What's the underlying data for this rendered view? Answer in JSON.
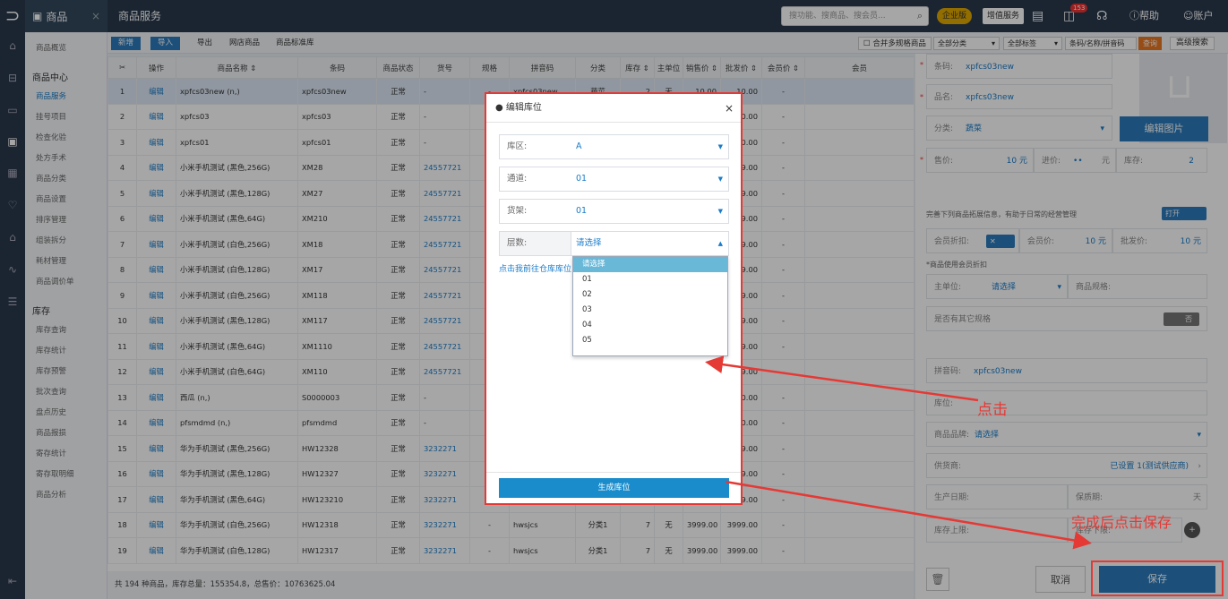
{
  "topbar": {
    "module_name": "商品",
    "close_glyph": "×",
    "page_title": "商品服务",
    "search_placeholder": "搜功能、搜商品、搜会员...",
    "search_icon": "search-icon",
    "enterprise_badge": "企业版",
    "value_service": "增值服务",
    "notify_count": "153",
    "help": "帮助",
    "account": "账户"
  },
  "rail": {
    "icons": [
      "home-icon",
      "store-icon",
      "card-icon",
      "goods-icon",
      "report-icon",
      "member-icon",
      "shop-icon",
      "chart-icon",
      "settings-icon"
    ]
  },
  "sidebar": {
    "overview": "商品概览",
    "center_heading": "商品中心",
    "center_items": [
      "商品服务",
      "挂号项目",
      "检查化验",
      "处方手术",
      "商品分类",
      "商品设置",
      "排序管理",
      "组装拆分",
      "耗材管理",
      "商品调价单"
    ],
    "stock_heading": "库存",
    "stock_items": [
      "库存查询",
      "库存统计",
      "库存预警",
      "批次查询",
      "盘点历史",
      "商品报损",
      "寄存统计",
      "寄存取明细",
      "商品分析"
    ]
  },
  "toolbar": {
    "new": "新增",
    "import": "导入",
    "export": "导出",
    "store_goods": "网店商品",
    "std_lib": "商品标准库",
    "merge": "合并多规格商品",
    "filter_category": "全部分类",
    "filter_tag": "全部标签",
    "filter_search": "条码/名称/拼音码",
    "query": "查询",
    "advanced": "高级搜索"
  },
  "table": {
    "headers": [
      "",
      "操作",
      "商品名称 ⇕",
      "条码",
      "商品状态",
      "货号",
      "规格",
      "拼音码",
      "分类",
      "库存 ⇕",
      "主单位",
      "销售价 ⇕",
      "批发价 ⇕",
      "会员价 ⇕",
      "会员"
    ],
    "rows": [
      [
        "1",
        "编辑",
        "xpfcs03new (n,)",
        "xpfcs03new",
        "正常",
        "-",
        "-",
        "xpfcs03new",
        "蔬菜",
        "2",
        "无",
        "10.00",
        "10.00",
        "-"
      ],
      [
        "2",
        "编辑",
        "xpfcs03",
        "xpfcs03",
        "正常",
        "-",
        "",
        "",
        "",
        "",
        "",
        "10.00",
        "10.00",
        "-"
      ],
      [
        "3",
        "编辑",
        "xpfcs01",
        "xpfcs01",
        "正常",
        "-",
        "",
        "",
        "",
        "",
        "",
        "10.00",
        "10.00",
        "-"
      ],
      [
        "4",
        "编辑",
        "小米手机测试 (黑色,256G)",
        "XM28",
        "正常",
        "24557721",
        "",
        "",
        "",
        "",
        "",
        "3999.00",
        "3999.00",
        "-"
      ],
      [
        "5",
        "编辑",
        "小米手机测试 (黑色,128G)",
        "XM27",
        "正常",
        "24557721",
        "",
        "",
        "",
        "",
        "",
        "3999.00",
        "3999.00",
        "-"
      ],
      [
        "6",
        "编辑",
        "小米手机测试 (黑色,64G)",
        "XM210",
        "正常",
        "24557721",
        "",
        "",
        "",
        "",
        "",
        "3999.00",
        "3999.00",
        "-"
      ],
      [
        "7",
        "编辑",
        "小米手机测试 (白色,256G)",
        "XM18",
        "正常",
        "24557721",
        "",
        "",
        "",
        "",
        "",
        "3999.00",
        "3999.00",
        "-"
      ],
      [
        "8",
        "编辑",
        "小米手机测试 (白色,128G)",
        "XM17",
        "正常",
        "24557721",
        "",
        "",
        "",
        "",
        "",
        "3999.00",
        "3999.00",
        "-"
      ],
      [
        "9",
        "编辑",
        "小米手机测试 (白色,256G)",
        "XM118",
        "正常",
        "24557721",
        "",
        "",
        "",
        "",
        "",
        "3999.00",
        "3999.00",
        "-"
      ],
      [
        "10",
        "编辑",
        "小米手机测试 (黑色,128G)",
        "XM117",
        "正常",
        "24557721",
        "",
        "",
        "",
        "",
        "",
        "3999.00",
        "3999.00",
        "-"
      ],
      [
        "11",
        "编辑",
        "小米手机测试 (黑色,64G)",
        "XM1110",
        "正常",
        "24557721",
        "",
        "",
        "",
        "",
        "",
        "3999.00",
        "3999.00",
        "-"
      ],
      [
        "12",
        "编辑",
        "小米手机测试 (白色,64G)",
        "XM110",
        "正常",
        "24557721",
        "",
        "",
        "",
        "",
        "",
        "3999.00",
        "3999.00",
        "-"
      ],
      [
        "13",
        "编辑",
        "西瓜 (n,)",
        "S0000003",
        "正常",
        "-",
        "",
        "",
        "",
        "",
        "",
        "150.00",
        "150.00",
        "-"
      ],
      [
        "14",
        "编辑",
        "pfsmdmd (n,)",
        "pfsmdmd",
        "正常",
        "-",
        "",
        "",
        "",
        "",
        "",
        "10.00",
        "10.00",
        "-"
      ],
      [
        "15",
        "编辑",
        "华为手机测试 (黑色,256G)",
        "HW12328",
        "正常",
        "3232271",
        "",
        "",
        "",
        "",
        "",
        "3999.00",
        "3999.00",
        "-"
      ],
      [
        "16",
        "编辑",
        "华为手机测试 (黑色,128G)",
        "HW12327",
        "正常",
        "3232271",
        "",
        "",
        "",
        "",
        "",
        "3999.00",
        "3999.00",
        "-"
      ],
      [
        "17",
        "编辑",
        "华为手机测试 (黑色,64G)",
        "HW123210",
        "正常",
        "3232271",
        "",
        "",
        "",
        "",
        "",
        "3999.00",
        "3999.00",
        "-"
      ],
      [
        "18",
        "编辑",
        "华为手机测试 (白色,256G)",
        "HW12318",
        "正常",
        "3232271",
        "-",
        "hwsjcs",
        "分类1",
        "7",
        "无",
        "3999.00",
        "3999.00",
        "-"
      ],
      [
        "19",
        "编辑",
        "华为手机测试 (白色,128G)",
        "HW12317",
        "正常",
        "3232271",
        "-",
        "hwsjcs",
        "分类1",
        "7",
        "无",
        "3999.00",
        "3999.00",
        "-"
      ]
    ],
    "footer": "共 194 种商品，库存总量：155354.8，总售价：10763625.04"
  },
  "right_panel": {
    "barcode_label": "条码:",
    "barcode_value": "xpfcs03new",
    "name_label": "品名:",
    "name_value": "xpfcs03new",
    "category_label": "分类:",
    "category_value": "蔬菜",
    "edit_image": "编辑图片",
    "price_label": "售价:",
    "price_value": "10 元",
    "cost_label": "进价:",
    "cost_value": "••",
    "cost_unit": "元",
    "stock_label": "库存:",
    "stock_value": "2",
    "hint": "完善下列商品拓展信息，有助于日常的经营管理",
    "toggle_on": "打开",
    "member_discount_label": "会员折扣:",
    "member_price_label": "会员价:",
    "member_price_value": "10 元",
    "wholesale_label": "批发价:",
    "wholesale_value": "10 元",
    "member_discount_note": "*商品使用会员折扣",
    "main_unit_label": "主单位:",
    "main_unit_value": "请选择",
    "spec_label": "商品规格:",
    "other_spec_label": "是否有其它规格",
    "toggle_off": "否",
    "pinyin_label": "拼音码:",
    "pinyin_value": "xpfcs03new",
    "location_label": "库位:",
    "brand_label": "商品品牌:",
    "brand_value": "请选择",
    "supplier_label": "供货商:",
    "supplier_value": "已设置 1(测试供应商)",
    "prod_date_label": "生产日期:",
    "shelf_life_label": "保质期:",
    "shelf_life_unit": "天",
    "stock_limit_label": "库存上限:",
    "stock_lower_label": "库存下限:",
    "cancel": "取消",
    "save": "保存"
  },
  "modal": {
    "title": "● 编辑库位",
    "close": "×",
    "zone_label": "库区:",
    "zone_value": "A",
    "aisle_label": "通道:",
    "aisle_value": "01",
    "shelf_label": "货架:",
    "shelf_value": "01",
    "layer_label": "层数:",
    "layer_value": "请选择",
    "link": "点击我前往仓库库位",
    "layer_options": [
      "请选择",
      "01",
      "02",
      "03",
      "04",
      "05"
    ],
    "generate": "生成库位"
  },
  "annotations": {
    "click": "点击",
    "save_after": "完成后点击保存",
    "color": "#e53935"
  }
}
